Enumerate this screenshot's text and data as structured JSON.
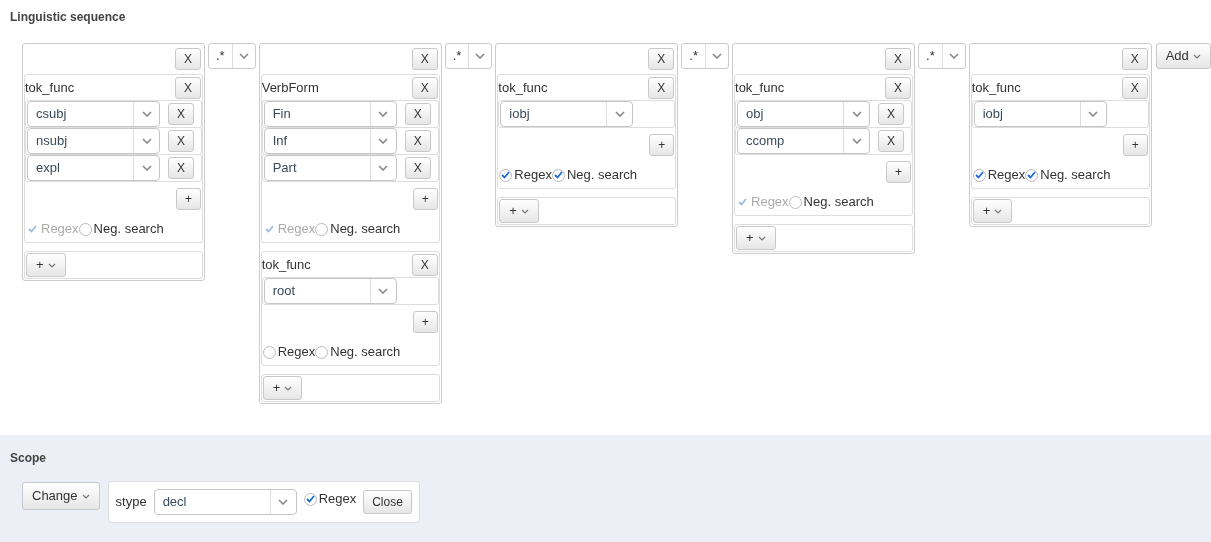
{
  "title": "Linguistic sequence",
  "tokens": [
    {
      "remove": "X",
      "operator": ".*",
      "conditions": [
        {
          "name": "tok_func",
          "remove": "X",
          "values": [
            {
              "value": "csubj",
              "remove": "X"
            },
            {
              "value": "nsubj",
              "remove": "X"
            },
            {
              "value": "expl",
              "remove": "X"
            }
          ],
          "add": "+",
          "regex": {
            "label": "Regex",
            "checked": true,
            "disabled": true
          },
          "negate": {
            "label": "Neg. search",
            "checked": false
          }
        }
      ],
      "add_menu": "+"
    },
    {
      "remove": "X",
      "operator": ".*",
      "conditions": [
        {
          "name": "VerbForm",
          "remove": "X",
          "values": [
            {
              "value": "Fin",
              "remove": "X"
            },
            {
              "value": "Inf",
              "remove": "X"
            },
            {
              "value": "Part",
              "remove": "X"
            }
          ],
          "add": "+",
          "regex": {
            "label": "Regex",
            "checked": true,
            "disabled": true
          },
          "negate": {
            "label": "Neg. search",
            "checked": false
          }
        },
        {
          "name": "tok_func",
          "remove": "X",
          "values": [
            {
              "value": "root"
            }
          ],
          "add": "+",
          "regex": {
            "label": "Regex",
            "checked": false,
            "disabled": false
          },
          "negate": {
            "label": "Neg. search",
            "checked": false
          }
        }
      ],
      "add_menu": "+"
    },
    {
      "remove": "X",
      "operator": ".*",
      "conditions": [
        {
          "name": "tok_func",
          "remove": "X",
          "values": [
            {
              "value": "iobj"
            }
          ],
          "add": "+",
          "regex": {
            "label": "Regex",
            "checked": true,
            "disabled": false
          },
          "negate": {
            "label": "Neg. search",
            "checked": true
          }
        }
      ],
      "add_menu": "+"
    },
    {
      "remove": "X",
      "operator": ".*",
      "conditions": [
        {
          "name": "tok_func",
          "remove": "X",
          "values": [
            {
              "value": "obj",
              "remove": "X"
            },
            {
              "value": "ccomp",
              "remove": "X"
            }
          ],
          "add": "+",
          "regex": {
            "label": "Regex",
            "checked": true,
            "disabled": true
          },
          "negate": {
            "label": "Neg. search",
            "checked": false
          }
        }
      ],
      "add_menu": "+"
    },
    {
      "remove": "X",
      "conditions": [
        {
          "name": "tok_func",
          "remove": "X",
          "values": [
            {
              "value": "iobj"
            }
          ],
          "add": "+",
          "regex": {
            "label": "Regex",
            "checked": true,
            "disabled": false
          },
          "negate": {
            "label": "Neg. search",
            "checked": true
          }
        }
      ],
      "add_menu": "+"
    }
  ],
  "add_button": "Add",
  "scope": {
    "title": "Scope",
    "change_button": "Change",
    "field_label": "stype",
    "value": "decl",
    "regex": {
      "label": "Regex",
      "checked": true
    },
    "close_button": "Close"
  }
}
